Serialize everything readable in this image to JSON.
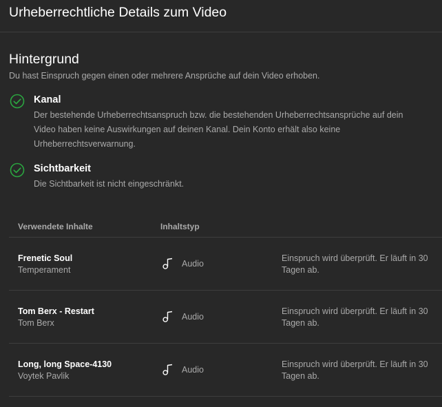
{
  "header": {
    "title": "Urheberrechtliche Details zum Video"
  },
  "background": {
    "title": "Hintergrund",
    "description": "Du hast Einspruch gegen einen oder mehrere Ansprüche auf dein Video erhoben."
  },
  "checks": [
    {
      "icon": "check-circle-icon",
      "title": "Kanal",
      "text": "Der bestehende Urheberrechtsanspruch bzw. die bestehenden Urheberrechtsansprüche auf dein Video haben keine Auswirkungen auf deinen Kanal. Dein Konto erhält also keine Urheberrechtsverwarnung."
    },
    {
      "icon": "check-circle-icon",
      "title": "Sichtbarkeit",
      "text": "Die Sichtbarkeit ist nicht eingeschränkt."
    }
  ],
  "table": {
    "headers": {
      "content": "Verwendete Inhalte",
      "type": "Inhaltstyp"
    },
    "rows": [
      {
        "title": "Frenetic Soul",
        "artist": "Temperament",
        "type_icon": "music-note-icon",
        "type": "Audio",
        "status": "Einspruch wird überprüft. Er läuft in 30 Tagen ab."
      },
      {
        "title": "Tom Berx - Restart",
        "artist": "Tom Berx",
        "type_icon": "music-note-icon",
        "type": "Audio",
        "status": "Einspruch wird überprüft. Er läuft in 30 Tagen ab."
      },
      {
        "title": "Long, long Space-4130",
        "artist": "Voytek Pavlik",
        "type_icon": "music-note-icon",
        "type": "Audio",
        "status": "Einspruch wird überprüft. Er läuft in 30 Tagen ab."
      }
    ]
  },
  "colors": {
    "background": "#282828",
    "divider": "#3e3e3e",
    "text_primary": "#ffffff",
    "text_secondary": "#aaaaaa",
    "check_green": "#2ba640"
  }
}
